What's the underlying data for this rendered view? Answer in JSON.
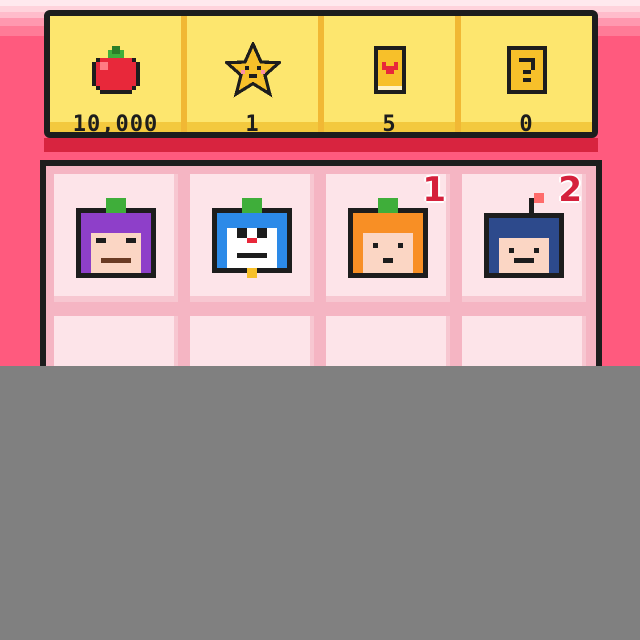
{
  "resources": [
    {
      "icon": "tomato-icon",
      "value": "10,000"
    },
    {
      "icon": "star-icon",
      "value": "1"
    },
    {
      "icon": "heart-book-icon",
      "value": "5"
    },
    {
      "icon": "question-block-icon",
      "value": "0"
    }
  ],
  "characters": [
    {
      "name": "purple-tomato-character",
      "badge": ""
    },
    {
      "name": "blue-robot-cat-character",
      "badge": ""
    },
    {
      "name": "orange-tomato-character",
      "badge": "1"
    },
    {
      "name": "bomb-character",
      "badge": "2"
    }
  ],
  "colors": {
    "background": "#ff5a7e",
    "resource_panel": "#fde66e",
    "grid_panel": "#f5b5c3",
    "badge": "#d5213c",
    "overlay": "#808080"
  }
}
